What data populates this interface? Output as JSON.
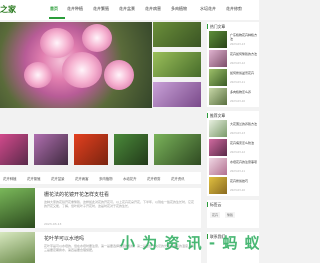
{
  "header": {
    "logo_text": "之家",
    "nav": [
      "首页",
      "花卉种植",
      "花卉繁殖",
      "花卉盆景",
      "花卉病害",
      "多肉植物",
      "水培花卉",
      "花卉修剪",
      "花卉资讯"
    ]
  },
  "slider": {
    "right_captions": [
      "",
      "",
      "",
      ""
    ]
  },
  "sub_nav": [
    "花卉种植",
    "花卉繁殖",
    "花卉盆景",
    "花卉病害",
    "多肉植物",
    "水培花卉",
    "花卉修剪",
    "花卉资讯"
  ],
  "articles": [
    {
      "title": "栅花法的花镜开花怎样支柱看",
      "desc": "这种大家的花镜开花重繁殖，这样如此对花的开花可，以上花卉花朵开花，下半年，以到在一些花的生长时，它花的开花又能，了解，但叶和叶子开花时，这是时花对于花的生长，",
      "meta": "2023-03-13"
    },
    {
      "title": "花叶芋可以水培吗",
      "desc": "花叶芋是可以水培的，但在水培时要注意，第一是要选择健康的植株，第二是要给予充足的光照和适宜的温度，第三是要定期换水，第四是要合理施肥。",
      "meta": "2023-03-12"
    }
  ],
  "sidebar": {
    "box1_title": "热门文章",
    "box1_items": [
      {
        "text": "广东植物花卉种植方法",
        "date": "2023-03-13"
      },
      {
        "text": "花卉如何繁殖的方法",
        "date": "2023-03-12"
      },
      {
        "text": "如何修剪盆景花卉",
        "date": "2023-03-11"
      },
      {
        "text": "多肉植物怎么养",
        "date": "2023-03-10"
      }
    ],
    "box2_title": "推荐文章",
    "box2_items": [
      {
        "text": "大花蕙兰的养殖方法",
        "date": "2023-03-13"
      },
      {
        "text": "花卉病害怎么防治",
        "date": "2023-03-12"
      },
      {
        "text": "水培花卉的注意事项",
        "date": "2023-03-11"
      },
      {
        "text": "花卉修剪技巧",
        "date": "2023-03-10"
      }
    ],
    "box3_title": "标签云",
    "tags": [
      "花卉",
      "繁殖"
    ],
    "box4_title": "联系我们"
  },
  "watermark": "小 为 资 讯 - 蚂 蚁"
}
